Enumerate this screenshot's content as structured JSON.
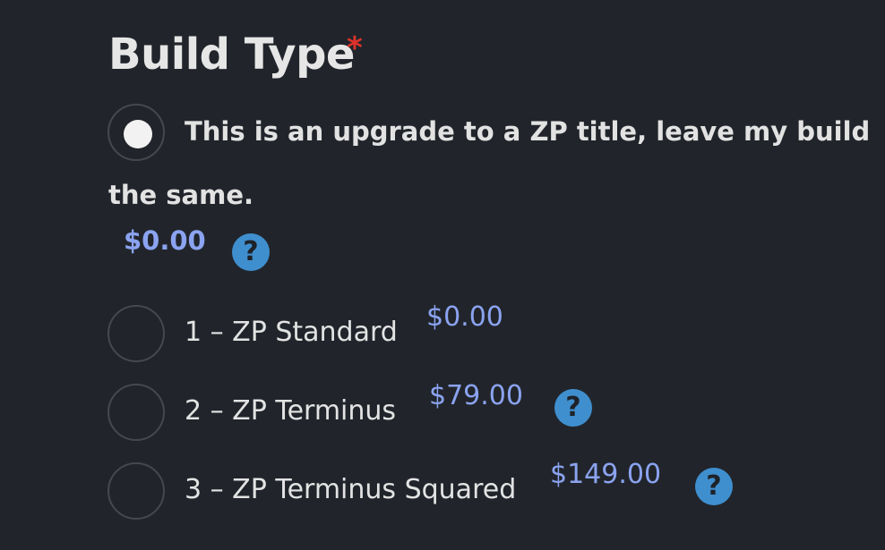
{
  "field": {
    "title": "Build Type",
    "required_marker": "*"
  },
  "options": [
    {
      "label_line1": "This is an upgrade to a ZP title, leave my build",
      "label_line2": "the same.",
      "price": "$0.00",
      "selected": true,
      "has_help": true
    },
    {
      "label": "1 – ZP Standard",
      "price": "$0.00",
      "selected": false,
      "has_help": false
    },
    {
      "label": "2 – ZP Terminus",
      "price": "$79.00",
      "selected": false,
      "has_help": true
    },
    {
      "label": "3 – ZP Terminus Squared",
      "price": "$149.00",
      "selected": false,
      "has_help": true
    }
  ],
  "help_icon_glyph": "?",
  "colors": {
    "background": "#21252b",
    "price": "#8ba3f0",
    "required": "#e0322b",
    "help_icon": "#3f8fcf"
  }
}
